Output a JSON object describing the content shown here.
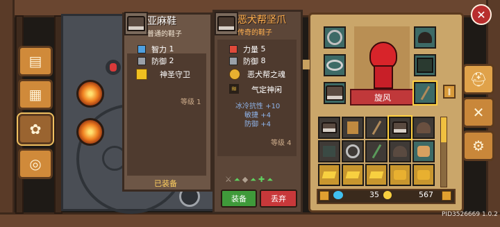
{
  "left_item": {
    "name": "亚麻鞋",
    "subtitle": "普通的鞋子",
    "stats": [
      {
        "label": "智力",
        "value": "1",
        "color": "#4fa0e0"
      },
      {
        "label": "防御",
        "value": "2",
        "color": "#9aa0a8"
      }
    ],
    "skill": "神圣守卫",
    "level": "等级 1",
    "equipped_label": "已装备"
  },
  "right_item": {
    "name": "恶犬帮坚爪",
    "subtitle": "传奇的鞋子",
    "stats": [
      {
        "label": "力量",
        "value": "5",
        "color": "#e04a3a"
      },
      {
        "label": "防御",
        "value": "8",
        "color": "#9aa0a8"
      }
    ],
    "skills": [
      "恶犬帮之魂",
      "气定神闲"
    ],
    "bonuses": [
      {
        "label": "冰冷抗性",
        "value": "+10"
      },
      {
        "label": "敏捷",
        "value": "+4"
      },
      {
        "label": "防御",
        "value": "+4"
      }
    ],
    "level": "等级 4",
    "equip_label": "装备",
    "discard_label": "丢弃"
  },
  "character": {
    "name": "旋风"
  },
  "currency": {
    "gems": "35",
    "coins": "567"
  },
  "build_id": "PID3526669 1.0.2",
  "icons": {
    "close": "close-icon",
    "helmet_tab": "helmet-icon",
    "weapons_tab": "crossed-swords-icon",
    "settings_tab": "gear-icon"
  }
}
